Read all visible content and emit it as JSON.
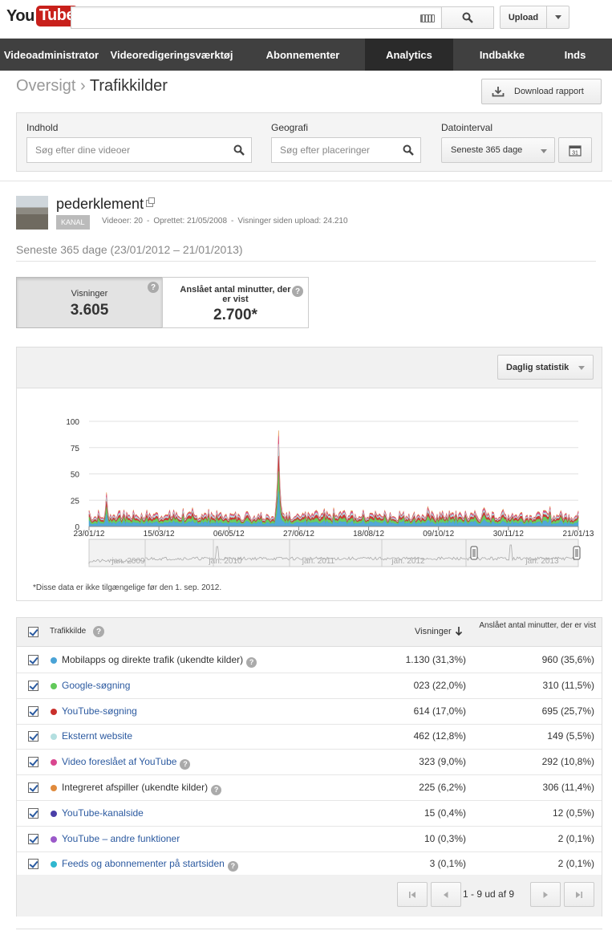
{
  "masthead": {
    "logo_you": "You",
    "logo_tube": "Tube",
    "search_value": "",
    "upload_label": "Upload"
  },
  "nav": {
    "tabs": [
      {
        "label": "Videoadministrator",
        "active": false
      },
      {
        "label": "Videoredigeringsværktøj",
        "active": false
      },
      {
        "label": "Abonnementer",
        "active": false
      },
      {
        "label": "Analytics",
        "active": true
      },
      {
        "label": "Indbakke",
        "active": false
      },
      {
        "label": "Inds",
        "active": false
      }
    ]
  },
  "header": {
    "breadcrumb_parent": "Oversigt",
    "breadcrumb_sep": "›",
    "breadcrumb_current": "Trafikkilder",
    "download_label": "Download rapport"
  },
  "filters": {
    "content_label": "Indhold",
    "content_placeholder": "Søg efter dine videoer",
    "geo_label": "Geografi",
    "geo_placeholder": "Søg efter placeringer",
    "date_label": "Datointerval",
    "date_value": "Seneste 365 dage",
    "calendar_day": "31"
  },
  "channel": {
    "name": "pederklement",
    "badge": "KANAL",
    "videos": "Videoer: 20",
    "created": "Oprettet: 21/05/2008",
    "views_since_upload": "Visninger siden upload: 24.210",
    "sep": "-",
    "range": "Seneste 365 dage (23/01/2012 – 21/01/2013)"
  },
  "metrics": {
    "views_label": "Visninger",
    "views_value": "3.605",
    "minutes_label": "Anslået antal minutter, der er vist",
    "minutes_value": "2.700*",
    "help": "?"
  },
  "chart": {
    "granularity_label": "Daglig statistik",
    "footnote": "*Disse data er ikke tilgængelige før den 1. sep. 2012.",
    "nav_labels": [
      "jan. 2009",
      "jan. 2010",
      "jan. 2011",
      "jan. 2012",
      "jan. 2013"
    ]
  },
  "chart_data": {
    "type": "area",
    "x_ticks": [
      "23/01/12",
      "15/03/12",
      "06/05/12",
      "27/06/12",
      "18/08/12",
      "09/10/12",
      "30/11/12",
      "21/01/13"
    ],
    "y_ticks": [
      0,
      25,
      50,
      75,
      100
    ],
    "ylim": [
      0,
      100
    ],
    "stacked": true,
    "grid": true,
    "legend": "none",
    "series": [
      {
        "name": "Mobilapps og direkte trafik (ukendte kilder)",
        "color": "#4aa3d6",
        "base": 3.2
      },
      {
        "name": "Google-søgning",
        "color": "#62c95a",
        "base": 2.2
      },
      {
        "name": "YouTube-søgning",
        "color": "#c9302c",
        "base": 1.7
      },
      {
        "name": "Eksternt website",
        "color": "#b3dfe0",
        "base": 1.3
      },
      {
        "name": "Video foreslået af YouTube",
        "color": "#d9468f",
        "base": 0.9
      },
      {
        "name": "Integreret afspiller (ukendte kilder)",
        "color": "#e08a3c",
        "base": 0.6
      }
    ],
    "peaks": [
      {
        "date": "05/02/12",
        "total": 32
      },
      {
        "date": "12/06/12",
        "total": 90
      }
    ]
  },
  "table": {
    "col_source": "Trafikkilde",
    "col_views": "Visninger",
    "col_minutes": "Anslået antal minutter, der er vist",
    "rows": [
      {
        "label": "Mobilapps og direkte trafik (ukendte kilder)",
        "color": "#4aa3d6",
        "link": false,
        "help": true,
        "views": "1.130 (31,3%)",
        "minutes": "960 (35,6%)"
      },
      {
        "label": "Google-søgning",
        "color": "#62c95a",
        "link": true,
        "help": false,
        "views": "023 (22,0%)",
        "minutes": "310 (11,5%)"
      },
      {
        "label": "YouTube-søgning",
        "color": "#c9302c",
        "link": true,
        "help": false,
        "views": "614 (17,0%)",
        "minutes": "695 (25,7%)"
      },
      {
        "label": "Eksternt website",
        "color": "#b3dfe0",
        "link": true,
        "help": false,
        "views": "462 (12,8%)",
        "minutes": "149 (5,5%)"
      },
      {
        "label": "Video foreslået af YouTube",
        "color": "#d9468f",
        "link": true,
        "help": true,
        "views": "323 (9,0%)",
        "minutes": "292 (10,8%)"
      },
      {
        "label": "Integreret afspiller (ukendte kilder)",
        "color": "#e08a3c",
        "link": false,
        "help": true,
        "views": "225 (6,2%)",
        "minutes": "306 (11,4%)"
      },
      {
        "label": "YouTube-kanalside",
        "color": "#4a3fa8",
        "link": true,
        "help": false,
        "views": "15 (0,4%)",
        "minutes": "12 (0,5%)"
      },
      {
        "label": "YouTube – andre funktioner",
        "color": "#9b59c9",
        "link": true,
        "help": false,
        "views": "10 (0,3%)",
        "minutes": "2 (0,1%)"
      },
      {
        "label": "Feeds og abonnementer på startsiden",
        "color": "#2fb7cf",
        "link": true,
        "help": true,
        "views": "3 (0,1%)",
        "minutes": "2 (0,1%)"
      }
    ],
    "pagination": "1 - 9 ud af 9"
  }
}
